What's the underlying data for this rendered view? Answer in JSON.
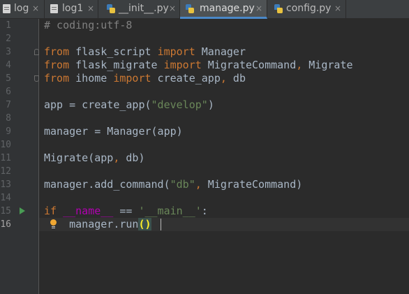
{
  "tabs": [
    {
      "label": "log",
      "close": "×",
      "icon": "text-file-icon",
      "active": false
    },
    {
      "label": "log1",
      "close": "×",
      "icon": "text-file-icon",
      "active": false
    },
    {
      "label": "__init__.py",
      "close": "×",
      "icon": "python-file-icon",
      "active": false
    },
    {
      "label": "manage.py",
      "close": "×",
      "icon": "python-file-icon",
      "active": true
    },
    {
      "label": "config.py",
      "close": "×",
      "icon": "python-file-icon",
      "active": false
    }
  ],
  "editor": {
    "current_line": 16,
    "line_numbers": [
      "1",
      "2",
      "3",
      "4",
      "5",
      "6",
      "7",
      "8",
      "9",
      "10",
      "11",
      "12",
      "13",
      "14",
      "15",
      "16"
    ],
    "lines": [
      {
        "segments": [
          {
            "t": "# coding:utf-8",
            "c": "cm"
          }
        ]
      },
      {
        "segments": []
      },
      {
        "segments": [
          {
            "t": "from",
            "c": "kw"
          },
          {
            "t": " flask_script ",
            "c": ""
          },
          {
            "t": "import",
            "c": "kw"
          },
          {
            "t": " Manager",
            "c": ""
          }
        ]
      },
      {
        "segments": [
          {
            "t": "from",
            "c": "kw"
          },
          {
            "t": " flask_migrate ",
            "c": ""
          },
          {
            "t": "import",
            "c": "kw"
          },
          {
            "t": " MigrateCommand",
            "c": ""
          },
          {
            "t": ",",
            "c": "kw"
          },
          {
            "t": " Migrate",
            "c": ""
          }
        ]
      },
      {
        "segments": [
          {
            "t": "from",
            "c": "kw"
          },
          {
            "t": " ihome ",
            "c": ""
          },
          {
            "t": "import",
            "c": "kw"
          },
          {
            "t": " create_app",
            "c": ""
          },
          {
            "t": ",",
            "c": "kw"
          },
          {
            "t": " db",
            "c": ""
          }
        ]
      },
      {
        "segments": []
      },
      {
        "segments": [
          {
            "t": "app = create_app(",
            "c": ""
          },
          {
            "t": "\"develop\"",
            "c": "str"
          },
          {
            "t": ")",
            "c": ""
          }
        ]
      },
      {
        "segments": []
      },
      {
        "segments": [
          {
            "t": "manager = Manager(app)",
            "c": ""
          }
        ]
      },
      {
        "segments": []
      },
      {
        "segments": [
          {
            "t": "Migrate(app",
            "c": ""
          },
          {
            "t": ",",
            "c": "kw"
          },
          {
            "t": " db)",
            "c": ""
          }
        ]
      },
      {
        "segments": []
      },
      {
        "segments": [
          {
            "t": "manager.add_command(",
            "c": ""
          },
          {
            "t": "\"db\"",
            "c": "str"
          },
          {
            "t": ",",
            "c": "kw"
          },
          {
            "t": " MigrateCommand)",
            "c": ""
          }
        ]
      },
      {
        "segments": []
      },
      {
        "segments": [
          {
            "t": "if",
            "c": "kw"
          },
          {
            "t": " ",
            "c": ""
          },
          {
            "t": "__name__",
            "c": "dunder"
          },
          {
            "t": " == ",
            "c": ""
          },
          {
            "t": "'__main__'",
            "c": "str"
          },
          {
            "t": ":",
            "c": ""
          }
        ]
      },
      {
        "segments": [
          {
            "t": "    manager.run",
            "c": ""
          },
          {
            "t": "()",
            "c": "paren-match"
          }
        ]
      }
    ]
  },
  "colors": {
    "background": "#2b2b2b",
    "gutter": "#313335",
    "keyword": "#cc7832",
    "string": "#6a8759",
    "comment": "#808080",
    "default_text": "#a9b7c6",
    "dunder": "#b200b2",
    "active_tab_underline": "#4a88c7"
  },
  "icons": {
    "gutter_run": "run-arrow-icon",
    "intention": "lightbulb-icon"
  }
}
